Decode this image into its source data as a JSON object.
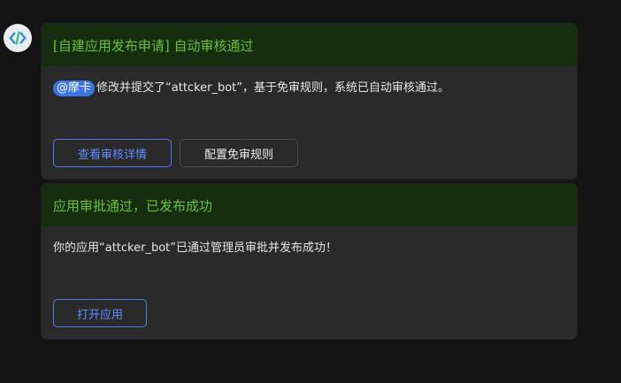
{
  "bot": {
    "avatar_icon": "code-brackets-icon"
  },
  "cards": [
    {
      "title": "[自建应用发布申请] 自动审核通过",
      "mention": "@摩卡",
      "message": "修改并提交了“attcker_bot”，基于免审规则，系统已自动审核通过。",
      "buttons": {
        "primary": "查看审核详情",
        "secondary": "配置免审规则"
      }
    },
    {
      "title": "应用审批通过，已发布成功",
      "message": "你的应用“attcker_bot”已通过管理员审批并发布成功！",
      "buttons": {
        "primary": "打开应用"
      }
    }
  ],
  "colors": {
    "header_bg": "#152e0d",
    "header_text": "#67c23a",
    "accent": "#4e7ff0",
    "card_bg": "#2a2a2a"
  }
}
